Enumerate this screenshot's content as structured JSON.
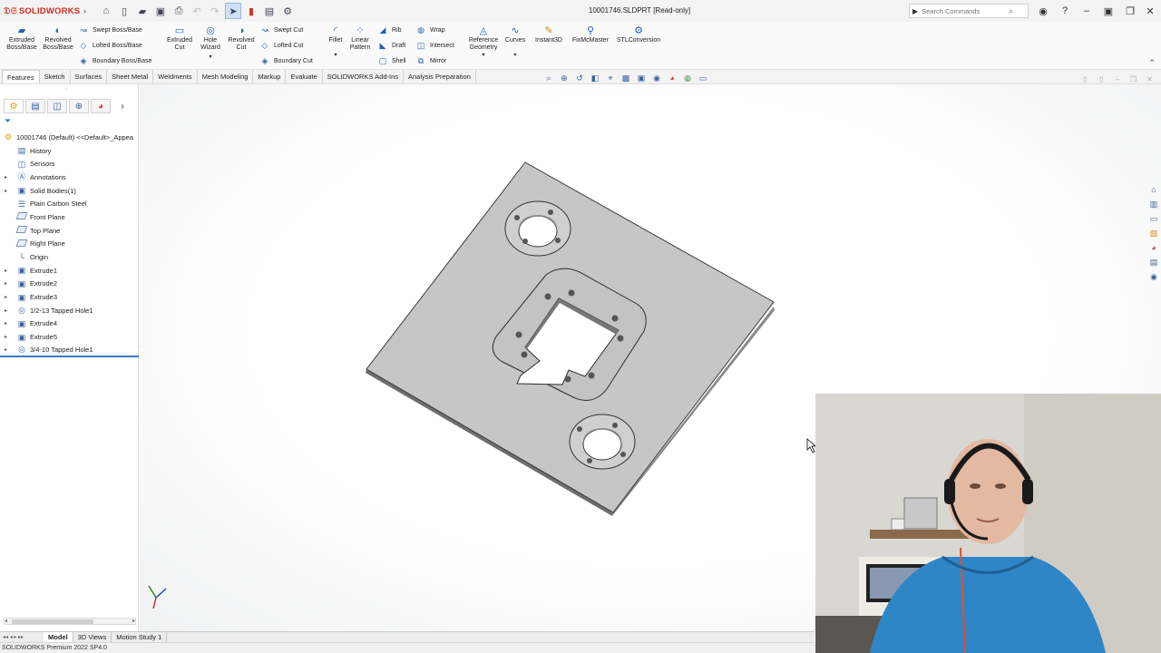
{
  "app": {
    "logo_text": "SOLIDWORKS",
    "document_title": "10001746.SLDPRT [Read-only]",
    "brand_color": "#d42a1e",
    "accent_color": "#3a78c3"
  },
  "search": {
    "placeholder": "Search Commands"
  },
  "ribbon": {
    "extruded_boss": "Extruded Boss/Base",
    "revolved_boss": "Revolved Boss/Base",
    "swept_boss": "Swept Boss/Base",
    "lofted_boss": "Lofted Boss/Base",
    "boundary_boss": "Boundary Boss/Base",
    "extruded_cut": "Extruded Cut",
    "hole_wizard": "Hole Wizard",
    "revolved_cut": "Revolved Cut",
    "swept_cut": "Swept Cut",
    "lofted_cut": "Lofted Cut",
    "boundary_cut": "Boundary Cut",
    "fillet": "Fillet",
    "linear_pattern": "Linear Pattern",
    "rib": "Rib",
    "draft": "Draft",
    "shell": "Shell",
    "wrap": "Wrap",
    "intersect": "Intersect",
    "mirror": "Mirror",
    "reference_geometry": "Reference Geometry",
    "curves": "Curves",
    "instant3d": "Instant3D",
    "fixmcmaster": "FixMcMaster",
    "stlconversion": "STLConversion"
  },
  "tabs": [
    "Features",
    "Sketch",
    "Surfaces",
    "Sheet Metal",
    "Weldments",
    "Mesh Modeling",
    "Markup",
    "Evaluate",
    "SOLIDWORKS Add-Ins",
    "Analysis Preparation"
  ],
  "active_tab": "Features",
  "tree": {
    "root": "10001746 (Default) <<Default>_Appea",
    "items": [
      {
        "label": "History",
        "expandable": false,
        "icon": "history-icon"
      },
      {
        "label": "Sensors",
        "expandable": false,
        "icon": "sensor-icon"
      },
      {
        "label": "Annotations",
        "expandable": true,
        "icon": "annotation-icon"
      },
      {
        "label": "Solid Bodies(1)",
        "expandable": true,
        "icon": "solid-bodies-icon"
      },
      {
        "label": "Plain Carbon Steel",
        "expandable": false,
        "icon": "material-icon"
      },
      {
        "label": "Front Plane",
        "expandable": false,
        "icon": "plane-icon"
      },
      {
        "label": "Top Plane",
        "expandable": false,
        "icon": "plane-icon"
      },
      {
        "label": "Right Plane",
        "expandable": false,
        "icon": "plane-icon"
      },
      {
        "label": "Origin",
        "expandable": false,
        "icon": "origin-icon"
      },
      {
        "label": "Extrude1",
        "expandable": true,
        "icon": "extrude-icon"
      },
      {
        "label": "Extrude2",
        "expandable": true,
        "icon": "extrude-icon"
      },
      {
        "label": "Extrude3",
        "expandable": true,
        "icon": "extrude-icon"
      },
      {
        "label": "1/2-13 Tapped Hole1",
        "expandable": true,
        "icon": "hole-icon"
      },
      {
        "label": "Extrude4",
        "expandable": true,
        "icon": "extrude-icon"
      },
      {
        "label": "Extrude5",
        "expandable": true,
        "icon": "extrude-icon"
      },
      {
        "label": "3/4-10 Tapped Hole1",
        "expandable": true,
        "icon": "hole-icon"
      }
    ]
  },
  "bottom_tabs": [
    "Model",
    "3D Views",
    "Motion Study 1"
  ],
  "active_bottom_tab": "Model",
  "status": "SOLIDWORKS Premium 2022 SP4.0"
}
